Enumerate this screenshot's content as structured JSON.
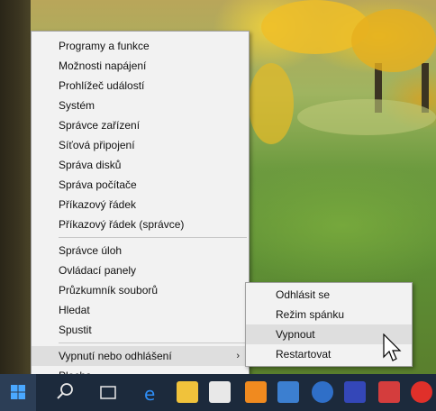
{
  "context_menu": {
    "items": [
      {
        "label": "Programy a funkce"
      },
      {
        "label": "Možnosti napájení"
      },
      {
        "label": "Prohlížeč událostí"
      },
      {
        "label": "Systém"
      },
      {
        "label": "Správce zařízení"
      },
      {
        "label": "Síťová připojení"
      },
      {
        "label": "Správa disků"
      },
      {
        "label": "Správa počítače"
      },
      {
        "label": "Příkazový řádek"
      },
      {
        "label": "Příkazový řádek (správce)"
      },
      {
        "label": "Správce úloh"
      },
      {
        "label": "Ovládací panely"
      },
      {
        "label": "Průzkumník souborů"
      },
      {
        "label": "Hledat"
      },
      {
        "label": "Spustit"
      },
      {
        "label": "Vypnutí nebo odhlášení",
        "arrow": "›"
      },
      {
        "label": "Plocha"
      }
    ]
  },
  "submenu": {
    "items": [
      {
        "label": "Odhlásit se"
      },
      {
        "label": "Režim spánku"
      },
      {
        "label": "Vypnout"
      },
      {
        "label": "Restartovat"
      }
    ]
  },
  "taskbar": {
    "icons": [
      "windows-start-icon",
      "search-icon",
      "task-view-icon",
      "edge-icon",
      "file-explorer-icon",
      "store-icon",
      "media-player-icon",
      "st3-app-icon",
      "globe-icon",
      "save-disk-icon",
      "image-app-icon",
      "recorder-icon"
    ]
  },
  "colors": {
    "menu_bg": "#f2f2f2",
    "highlight": "#dedede",
    "taskbar": "#1c2a3c"
  }
}
